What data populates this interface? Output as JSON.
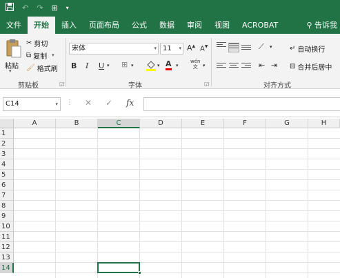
{
  "quick_access": {
    "save_icon": "save-icon",
    "undo_icon": "undo-icon",
    "redo_icon": "redo-icon",
    "touch_icon": "touch-mode-icon",
    "customize_icon": "customize-qat-icon"
  },
  "tabs": [
    {
      "label": "文件",
      "active": false
    },
    {
      "label": "开始",
      "active": true
    },
    {
      "label": "插入",
      "active": false
    },
    {
      "label": "页面布局",
      "active": false
    },
    {
      "label": "公式",
      "active": false
    },
    {
      "label": "数据",
      "active": false
    },
    {
      "label": "审阅",
      "active": false
    },
    {
      "label": "视图",
      "active": false
    },
    {
      "label": "ACROBAT",
      "active": false
    }
  ],
  "tell_me": "告诉我",
  "clipboard": {
    "paste": "粘贴",
    "cut": "剪切",
    "copy": "复制",
    "format_painter": "格式刷",
    "group": "剪贴板"
  },
  "font": {
    "name": "宋体",
    "size": "11",
    "grow": "A",
    "shrink": "A",
    "bold": "B",
    "italic": "I",
    "underline": "U",
    "color_letter": "A",
    "phonetic": "wén",
    "group": "字体"
  },
  "alignment": {
    "wrap_text": "自动换行",
    "merge_center": "合并后居中",
    "group": "对齐方式"
  },
  "formula_bar": {
    "name_box": "C14",
    "cancel": "✕",
    "enter": "✓",
    "fx": "fx",
    "value": ""
  },
  "grid": {
    "columns": [
      "A",
      "B",
      "C",
      "D",
      "E",
      "F",
      "G",
      "H"
    ],
    "rows": [
      "1",
      "2",
      "3",
      "4",
      "5",
      "6",
      "7",
      "8",
      "9",
      "10",
      "11",
      "12",
      "13",
      "14"
    ],
    "selected_column": "C",
    "selected_row": "14"
  },
  "colors": {
    "accent": "#217346",
    "ribbon_bg": "#f3f3f3",
    "highlight_yellow": "#ffff00",
    "font_red": "#e00000"
  }
}
